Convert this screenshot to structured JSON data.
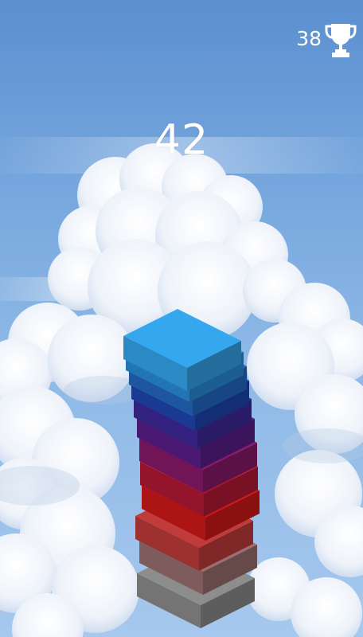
{
  "hud": {
    "current_score": "42",
    "best_score": "38",
    "trophy_icon": "trophy-icon"
  },
  "tower": {
    "top_block_color": "#35a7ee",
    "block_colors_top_to_bottom": [
      "#2a8fdd",
      "#2569c6",
      "#1f46b2",
      "#3f2a9c",
      "#5a1f8c",
      "#8b1a6a",
      "#b41a35",
      "#d31818",
      "#c23b3b",
      "#9a7070",
      "#8d8d8d"
    ]
  }
}
